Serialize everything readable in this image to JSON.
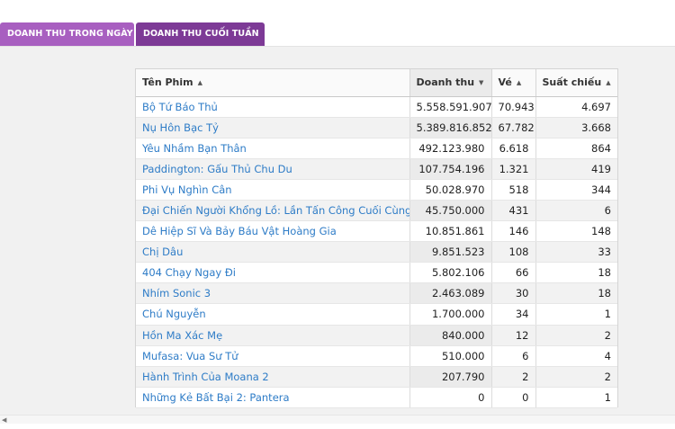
{
  "tabs": [
    {
      "label": "DOANH THU TRONG NGÀY"
    },
    {
      "label": "DOANH THU CUỐI TUẦN"
    }
  ],
  "table": {
    "columns": [
      {
        "label": "Tên Phim",
        "sort_icon": "sort-asc-icon"
      },
      {
        "label": "Doanh thu",
        "sort_icon": "sort-desc-icon"
      },
      {
        "label": "Vé",
        "sort_icon": "sort-asc-icon"
      },
      {
        "label": "Suất chiếu",
        "sort_icon": "sort-asc-icon"
      }
    ],
    "rows": [
      {
        "name": "Bộ Tứ Báo Thủ",
        "revenue": "5.558.591.907",
        "tickets": "70.943",
        "shows": "4.697"
      },
      {
        "name": "Nụ Hôn Bạc Tỷ",
        "revenue": "5.389.816.852",
        "tickets": "67.782",
        "shows": "3.668"
      },
      {
        "name": "Yêu Nhầm Bạn Thân",
        "revenue": "492.123.980",
        "tickets": "6.618",
        "shows": "864"
      },
      {
        "name": "Paddington: Gấu Thủ Chu Du",
        "revenue": "107.754.196",
        "tickets": "1.321",
        "shows": "419"
      },
      {
        "name": "Phi Vụ Nghìn Cân",
        "revenue": "50.028.970",
        "tickets": "518",
        "shows": "344"
      },
      {
        "name": "Đại Chiến Người Khổng Lồ: Lần Tấn Công Cuối Cùng",
        "revenue": "45.750.000",
        "tickets": "431",
        "shows": "6"
      },
      {
        "name": "Dê Hiệp Sĩ Và Bảy Báu Vật Hoàng Gia",
        "revenue": "10.851.861",
        "tickets": "146",
        "shows": "148"
      },
      {
        "name": "Chị Dâu",
        "revenue": "9.851.523",
        "tickets": "108",
        "shows": "33"
      },
      {
        "name": "404 Chạy Ngay Đi",
        "revenue": "5.802.106",
        "tickets": "66",
        "shows": "18"
      },
      {
        "name": "Nhím Sonic 3",
        "revenue": "2.463.089",
        "tickets": "30",
        "shows": "18"
      },
      {
        "name": "Chú Nguyễn",
        "revenue": "1.700.000",
        "tickets": "34",
        "shows": "1"
      },
      {
        "name": "Hồn Ma Xác Mẹ",
        "revenue": "840.000",
        "tickets": "12",
        "shows": "2"
      },
      {
        "name": "Mufasa: Vua Sư Tử",
        "revenue": "510.000",
        "tickets": "6",
        "shows": "4"
      },
      {
        "name": "Hành Trình Của Moana 2",
        "revenue": "207.790",
        "tickets": "2",
        "shows": "2"
      },
      {
        "name": "Những Kẻ Bất Bại 2: Pantera",
        "revenue": "0",
        "tickets": "0",
        "shows": "1"
      }
    ]
  },
  "colors": {
    "tab_inactive": "#a85fc0",
    "tab_active": "#7d3a96",
    "link": "#2e7cc7"
  }
}
